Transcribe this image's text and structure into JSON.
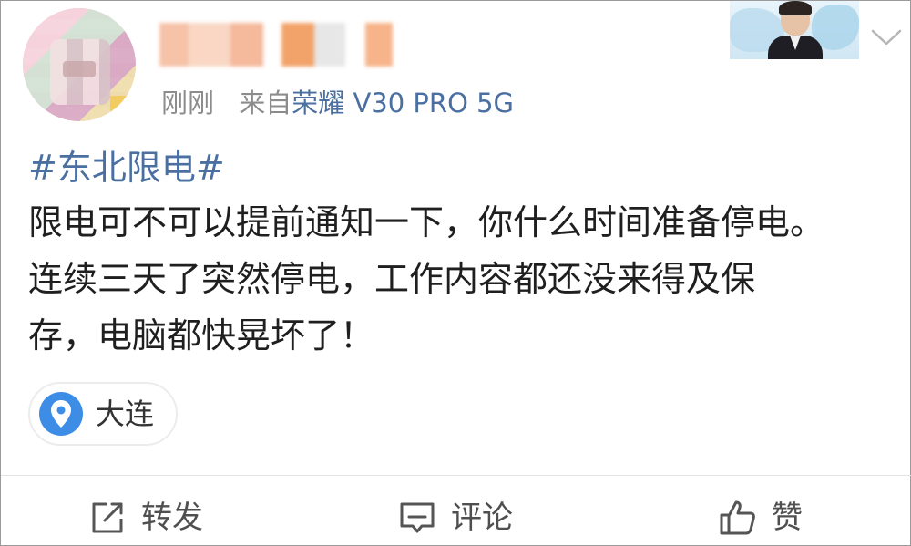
{
  "post": {
    "time": "刚刚",
    "source_prefix": "来自",
    "device": "荣耀 V30 PRO 5G",
    "hashtag": "#东北限电#",
    "lines": [
      "限电可不可以提前通知一下，你什么时间准备停电。",
      "连续三天了突然停电，工作内容都还没来得及保",
      "存，电脑都快晃坏了！"
    ],
    "location": "大连"
  },
  "actions": {
    "repost": "转发",
    "comment": "评论",
    "like": "赞"
  },
  "icons": {
    "chevron": "chevron-down-icon",
    "location": "location-pin-icon",
    "repost": "share-icon",
    "comment": "comment-icon",
    "like": "thumbs-up-icon"
  },
  "colors": {
    "link": "#4a6fa0",
    "muted": "#8c8c8c",
    "pin": "#3d8ce6"
  }
}
